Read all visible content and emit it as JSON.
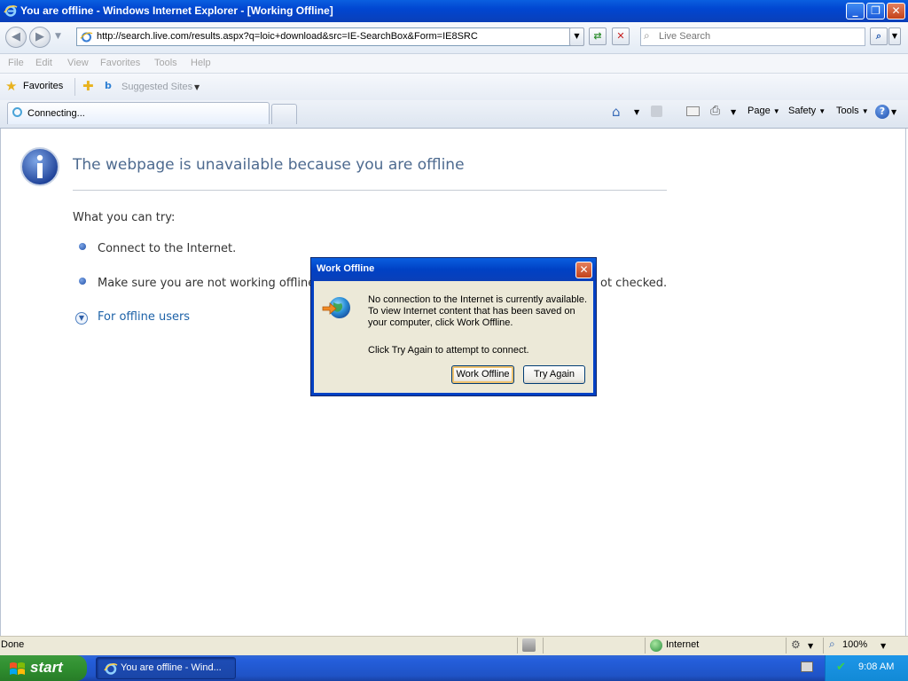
{
  "window": {
    "title": "You are offline - Windows Internet Explorer - [Working Offline]"
  },
  "address": {
    "url": "http://search.live.com/results.aspx?q=loic+download&src=IE-SearchBox&Form=IE8SRC",
    "search_placeholder": "Live Search"
  },
  "menu": {
    "items": [
      "File",
      "Edit",
      "View",
      "Favorites",
      "Tools",
      "Help"
    ]
  },
  "favorites": {
    "label": "Favorites",
    "suggested": "Suggested Sites"
  },
  "tab": {
    "label": "Connecting..."
  },
  "commandbar": {
    "page": "Page",
    "safety": "Safety",
    "tools": "Tools"
  },
  "content": {
    "headline": "The webpage is unavailable because you are offline",
    "try_label": "What you can try:",
    "tips": [
      "Connect to the Internet.",
      "Make sure you are not working offline."
    ],
    "tip_tail": "ot checked.",
    "offline_link": "For offline users"
  },
  "dialog": {
    "title": "Work Offline",
    "lines": [
      "No connection to the Internet is currently available.",
      "To view Internet content that has been saved on",
      "your computer, click Work Offline."
    ],
    "hint": "Click Try Again to attempt to connect.",
    "work_offline": "Work Offline",
    "try_again": "Try Again"
  },
  "status": {
    "left": "Done",
    "zone": "Internet",
    "zoom": "100%"
  },
  "taskbar": {
    "start": "start",
    "item": "You are offline - Wind...",
    "clock": "9:08 AM"
  }
}
